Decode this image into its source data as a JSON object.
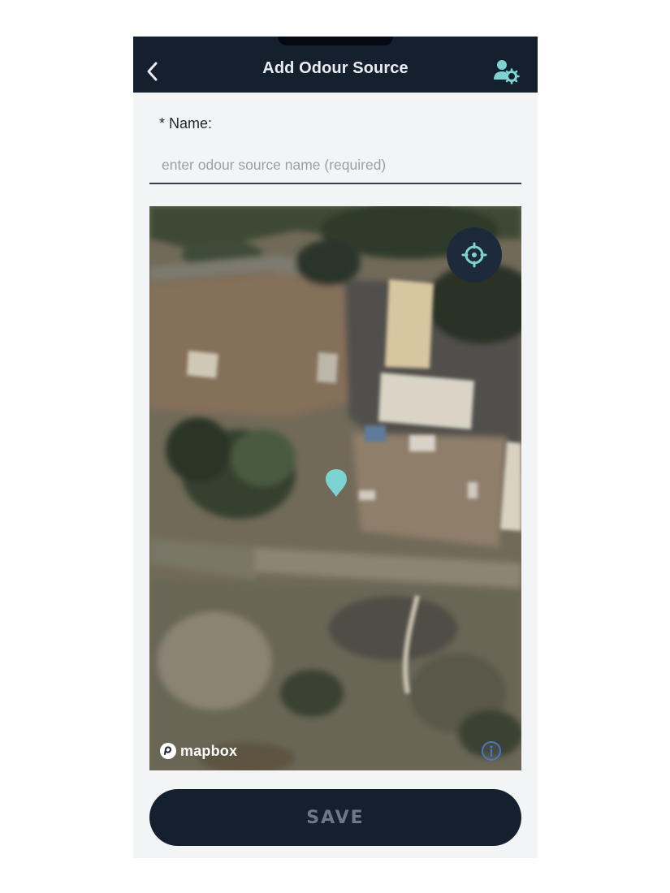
{
  "header": {
    "title": "Add Odour Source",
    "back_icon": "chevron-left-icon",
    "settings_icon": "user-settings-icon"
  },
  "form": {
    "name_label": "* Name:",
    "name_value": "",
    "name_placeholder": "enter odour source name (required)"
  },
  "map": {
    "attribution_logo": "mapbox",
    "locate_icon": "crosshair-icon",
    "marker_icon": "map-pin-icon",
    "info_icon": "info-icon"
  },
  "actions": {
    "save_label": "SAVE"
  },
  "colors": {
    "header_bg": "#15202f",
    "accent": "#7dd3d1",
    "screen_bg": "#f3f4f6"
  }
}
